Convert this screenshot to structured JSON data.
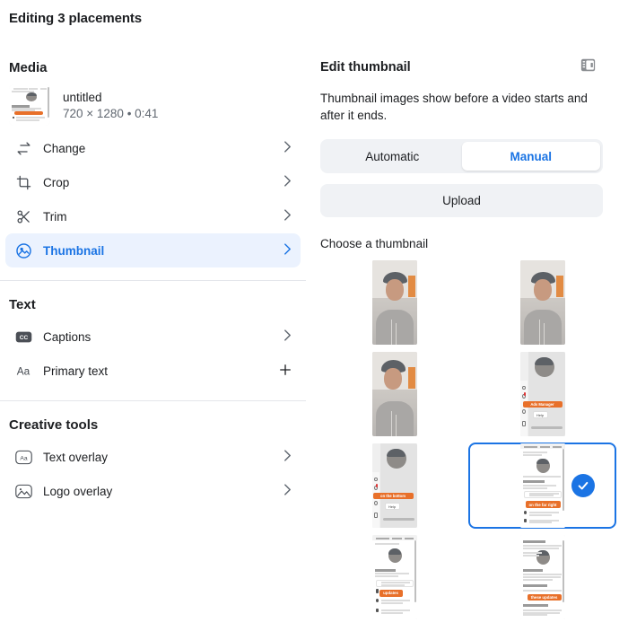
{
  "header": {
    "title": "Editing 3 placements"
  },
  "left": {
    "media_section": {
      "heading": "Media",
      "item": {
        "name": "untitled",
        "details": "720 × 1280 • 0:41",
        "thumb_icon": "video-thumbnail"
      },
      "rows": [
        {
          "label": "Change",
          "icon": "swap-arrows-icon",
          "action": "chevron-right-icon"
        },
        {
          "label": "Crop",
          "icon": "crop-icon",
          "action": "chevron-right-icon"
        },
        {
          "label": "Trim",
          "icon": "scissors-icon",
          "action": "chevron-right-icon"
        },
        {
          "label": "Thumbnail",
          "icon": "image-circle-icon",
          "action": "chevron-right-icon",
          "selected": true
        }
      ]
    },
    "text_section": {
      "heading": "Text",
      "rows": [
        {
          "label": "Captions",
          "icon": "closed-captions-icon",
          "action": "chevron-right-icon"
        },
        {
          "label": "Primary text",
          "icon": "aa-text-icon",
          "action": "plus-icon"
        }
      ]
    },
    "creative_section": {
      "heading": "Creative tools",
      "rows": [
        {
          "label": "Text overlay",
          "icon": "text-overlay-icon",
          "action": "chevron-right-icon"
        },
        {
          "label": "Logo overlay",
          "icon": "logo-overlay-icon",
          "action": "chevron-right-icon"
        }
      ]
    }
  },
  "right": {
    "title": "Edit thumbnail",
    "panel_toggle_icon": "panel-layout-icon",
    "description": "Thumbnail images show before a video starts and after it ends.",
    "segments": [
      {
        "label": "Automatic",
        "selected": false
      },
      {
        "label": "Manual",
        "selected": true
      }
    ],
    "upload_label": "Upload",
    "choose_label": "Choose a thumbnail",
    "thumbnails": [
      {
        "id": 1,
        "kind": "selfie",
        "selected": false
      },
      {
        "id": 2,
        "kind": "selfie",
        "selected": false
      },
      {
        "id": 3,
        "kind": "selfie",
        "selected": false
      },
      {
        "id": 4,
        "kind": "screen",
        "selected": false,
        "caption": "Ads Manager",
        "chip": "Help"
      },
      {
        "id": 5,
        "kind": "screen",
        "selected": false,
        "caption": "on the bottom",
        "chip": "Help"
      },
      {
        "id": 6,
        "kind": "doc",
        "selected": true,
        "caption": "on the far right"
      },
      {
        "id": 7,
        "kind": "doc",
        "selected": false,
        "caption": "updates"
      },
      {
        "id": 8,
        "kind": "doc",
        "selected": false,
        "caption": "these updates"
      }
    ]
  },
  "colors": {
    "accent": "#1b74e4",
    "accent_soft": "#ebf2fe",
    "surface": "#f0f2f5",
    "text": "#1c1e21",
    "text_secondary": "#606770",
    "divider": "#e4e6eb",
    "orange": "#e8702a"
  }
}
